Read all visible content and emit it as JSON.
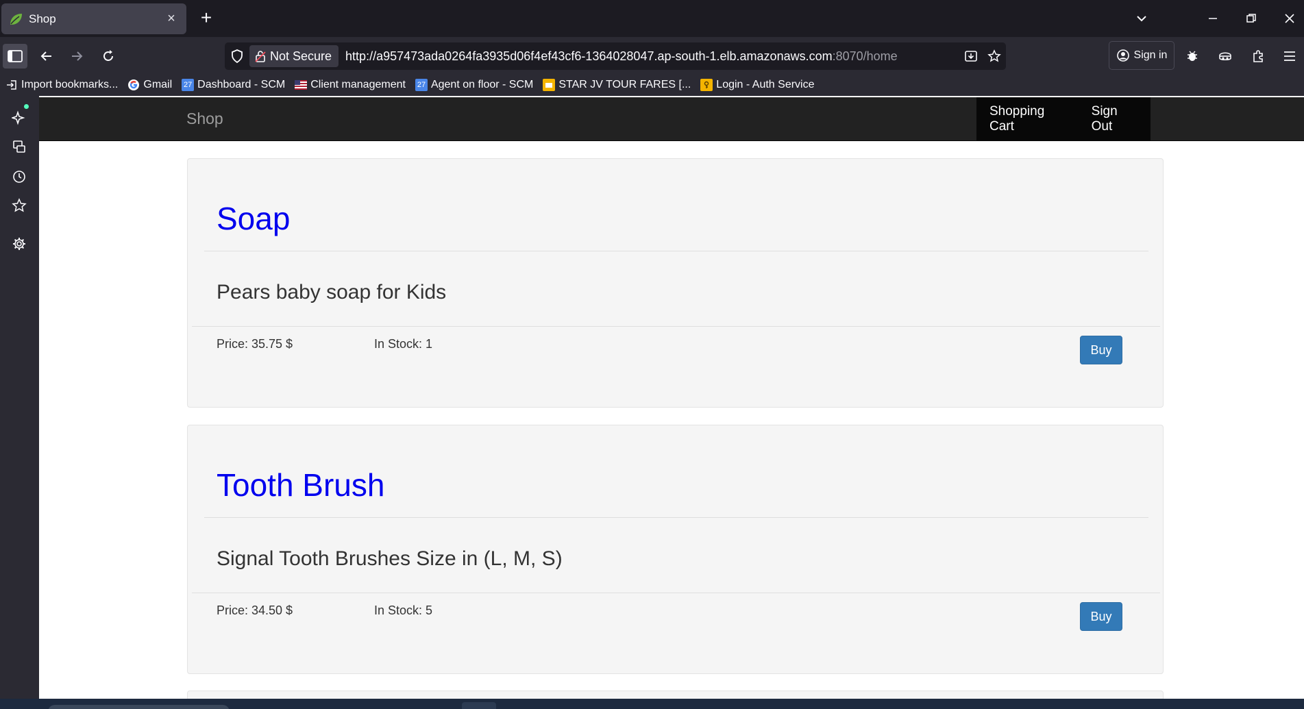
{
  "browser": {
    "tab": {
      "title": "Shop",
      "close": "×"
    },
    "new_tab": "+",
    "url": {
      "security_label": "Not Secure",
      "address": "http://a957473ada0264fa3935d06f4ef43cf6-1364028047.ap-south-1.elb.amazonaws.com",
      "address_dim": ":8070/home"
    },
    "sign_in": "Sign in",
    "bookmarks": [
      {
        "label": "Import bookmarks...",
        "icon": "import-icon"
      },
      {
        "label": "Gmail",
        "icon": "google-icon"
      },
      {
        "label": "Dashboard - SCM",
        "icon": "calendar-icon"
      },
      {
        "label": "Client management",
        "icon": "flag-icon"
      },
      {
        "label": "Agent on floor - SCM",
        "icon": "calendar-icon"
      },
      {
        "label": "STAR JV TOUR FARES [...",
        "icon": "slides-icon"
      },
      {
        "label": "Login - Auth Service",
        "icon": "key-icon"
      }
    ]
  },
  "site": {
    "brand": "Shop",
    "nav": {
      "cart": "Shopping Cart",
      "signout": "Sign Out"
    },
    "products": [
      {
        "name": "Soap",
        "description": "Pears baby soap for Kids",
        "price": "Price: 35.75 $",
        "stock": "In Stock: 1",
        "buy": "Buy"
      },
      {
        "name": "Tooth Brush",
        "description": "Signal Tooth Brushes Size in (L, M, S)",
        "price": "Price: 34.50 $",
        "stock": "In Stock: 5",
        "buy": "Buy"
      }
    ]
  },
  "colors": {
    "link": "#0000ee",
    "navbar": "#222222",
    "buy_button": "#337ab7",
    "panel": "#f5f5f5"
  }
}
